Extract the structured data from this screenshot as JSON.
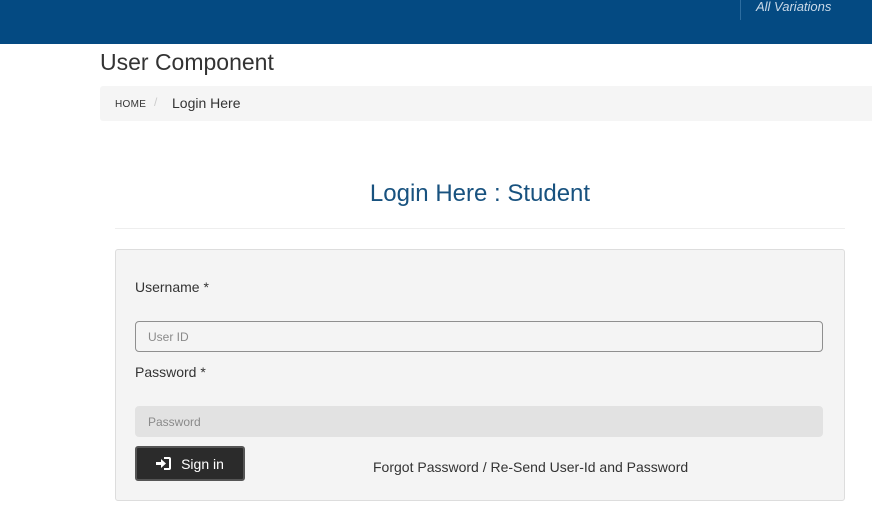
{
  "topbar": {
    "variations_label": "All Variations"
  },
  "page": {
    "title": "User Component"
  },
  "breadcrumb": {
    "home": "HOME",
    "separator": "/",
    "current": "Login Here"
  },
  "login": {
    "heading": "Login Here : Student",
    "username_label": "Username *",
    "username_placeholder": "User ID",
    "password_label": "Password *",
    "password_placeholder": "Password",
    "signin_label": "Sign in",
    "signin_icon": "sign-in-icon",
    "forgot_link": "Forgot Password / Re-Send User-Id and Password"
  },
  "colors": {
    "header": "#044a82",
    "heading_text": "#18527f",
    "panel_bg": "#f4f4f4",
    "button_bg": "#2b2b2b"
  }
}
